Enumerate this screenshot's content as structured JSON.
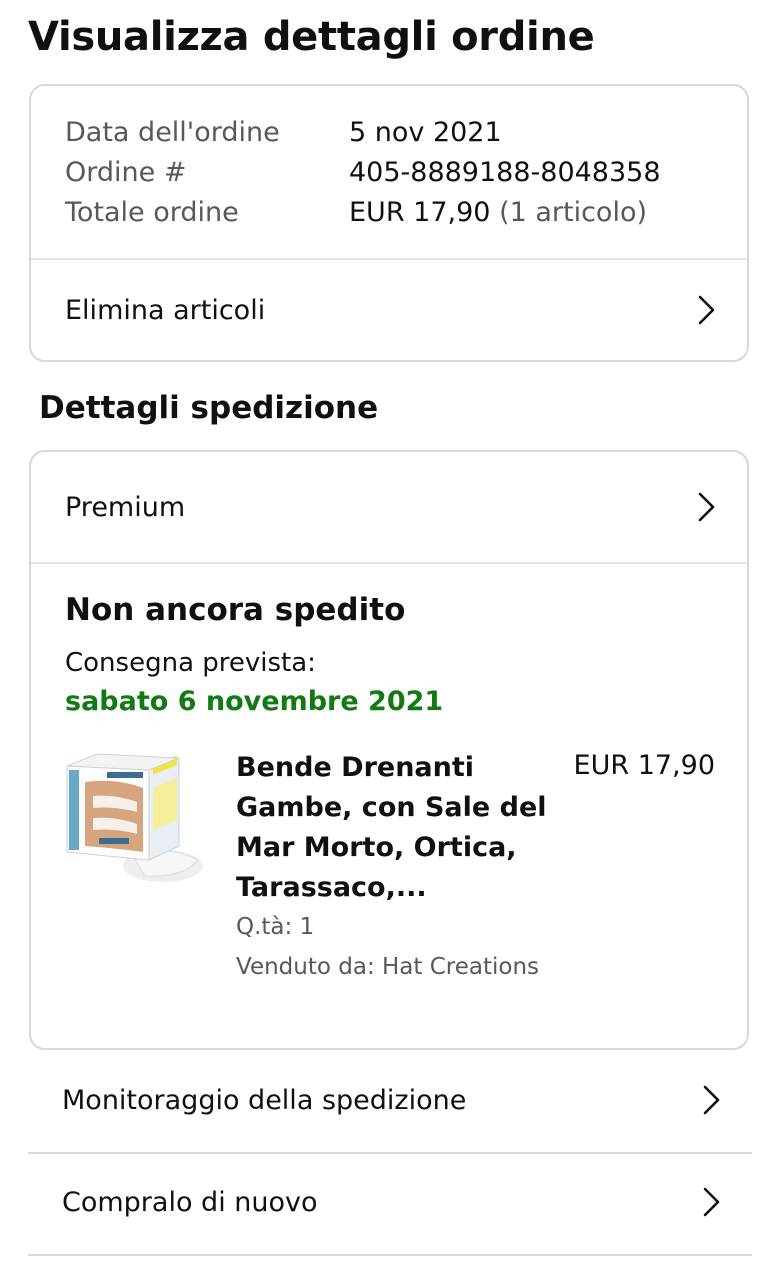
{
  "page": {
    "title": "Visualizza dettagli ordine"
  },
  "summary": {
    "rows": [
      {
        "label": "Data dell'ordine",
        "value": "5 nov 2021"
      },
      {
        "label": "Ordine #",
        "value": "405-8889188-8048358"
      },
      {
        "label": "Totale ordine",
        "value": "EUR 17,90",
        "extra": "(1 articolo)"
      }
    ],
    "delete_items_label": "Elimina articoli"
  },
  "shipping": {
    "heading": "Dettagli spedizione",
    "service_label": "Premium",
    "status": "Non ancora spedito",
    "delivery_label": "Consegna prevista:",
    "delivery_date": "sabato 6 novembre 2021",
    "product": {
      "title": "Bende Drenanti Gambe, con Sale del Mar Morto, Ortica, Tarassaco,...",
      "price": "EUR 17,90",
      "qty": "Q.tà: 1",
      "seller": "Venduto da: Hat Creations",
      "image_icon": "product-box-image"
    }
  },
  "actions": {
    "track_label": "Monitoraggio della spedizione",
    "buy_again_label": "Compralo di nuovo"
  },
  "colors": {
    "delivery_green": "#127a12",
    "border": "#d5d9d9",
    "muted_text": "#565959"
  }
}
